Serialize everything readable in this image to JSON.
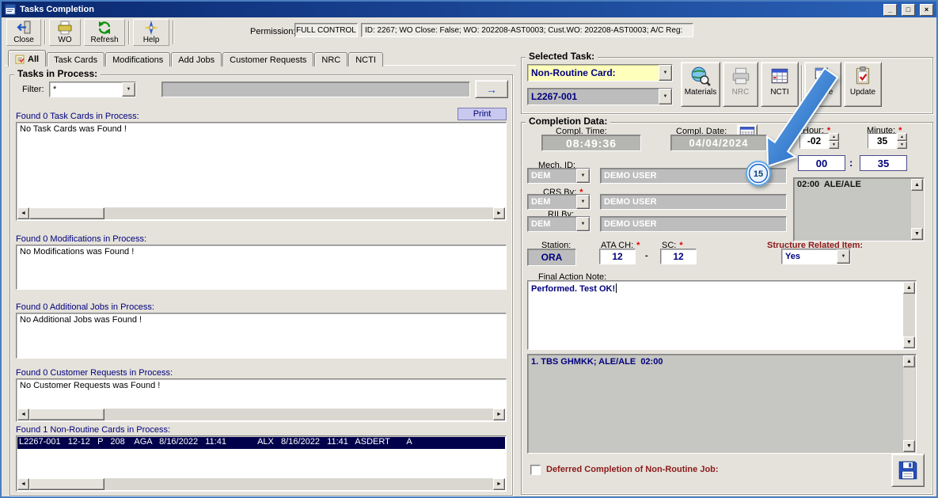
{
  "window": {
    "title": "Tasks Completion"
  },
  "icons": {
    "minimize": "_",
    "maximize": "□",
    "close_x": "×",
    "dropdown": "▼",
    "spin_up": "▲",
    "spin_down": "▼",
    "scroll_left": "◄",
    "scroll_right": "►",
    "scroll_up": "▲",
    "scroll_down": "▼",
    "go_arrow": "→"
  },
  "toolbar": {
    "close_label": "Close",
    "wo_label": "WO",
    "refresh_label": "Refresh",
    "help_label": "Help",
    "permission_label": "Permission:",
    "permission_value": "FULL CONTROL",
    "info_text": "ID: 2267; WO Close: False; WO: 202208-AST0003; Cust.WO: 202208-AST0003; A/C Reg:"
  },
  "tabs": [
    {
      "label": "All"
    },
    {
      "label": "Task Cards"
    },
    {
      "label": "Modifications"
    },
    {
      "label": "Add Jobs"
    },
    {
      "label": "Customer Requests"
    },
    {
      "label": "NRC"
    },
    {
      "label": "NCTI"
    }
  ],
  "tasks_in_process": {
    "title": "Tasks in Process:",
    "filter_label": "Filter:",
    "filter_value": "*",
    "print_label": "Print",
    "task_cards_header": "Found 0 Task Cards in Process:",
    "task_cards_empty": "No Task Cards was Found !",
    "modifications_header": "Found 0 Modifications in Process:",
    "modifications_empty": "No Modifications was Found !",
    "add_jobs_header": "Found 0 Additional Jobs in Process:",
    "add_jobs_empty": "No Additional Jobs was Found !",
    "customer_requests_header": "Found 0 Customer Requests in Process:",
    "customer_requests_empty": "No Customer Requests was Found !",
    "nrc_header": "Found 1 Non-Routine Cards in Process:",
    "nrc_row": "L2267-001   12-12   P   208    AGA   8/16/2022   11:41             ALX   8/16/2022   11:41   ASDERT       A"
  },
  "selected_task": {
    "title": "Selected Task:",
    "type_value": "Non-Routine Card:",
    "card_value": "L2267-001",
    "materials_label": "Materials",
    "nrc_label": "NRC",
    "ncti_label": "NCTI",
    "close_label": "Close",
    "update_label": "Update"
  },
  "completion_data": {
    "title": "Completion Data:",
    "compl_time_label": "Compl. Time:",
    "compl_time_value": "08:49:36",
    "compl_date_label": "Compl. Date:",
    "compl_date_value": "04/04/2024",
    "hour_label": "Hour:",
    "hour_value": "-02",
    "minute_label": "Minute:",
    "minute_value": "35",
    "required_marker": "*",
    "total_hour": "00",
    "time_colon": ":",
    "total_minute": "35",
    "mech_id_label": "Mech. ID:",
    "mech_id_value": "DEM",
    "mech_id_name": "DEMO USER",
    "hours_note": "02:00  ALE/ALE",
    "crs_by_label": "CRS By:",
    "crs_by_value": "DEM",
    "crs_by_name": "DEMO USER",
    "rii_by_label": "RII By:",
    "rii_by_value": "DEM",
    "rii_by_name": "DEMO USER",
    "station_label": "Station:",
    "station_value": "ORA",
    "ata_ch_label": "ATA CH:",
    "ata_ch_value": "12",
    "ata_sc_separator": "-",
    "sc_label": "SC:",
    "sc_value": "12",
    "structure_related_label": "Structure Related Item:",
    "structure_related_value": "Yes",
    "final_action_note_label": "Final Action Note:",
    "final_action_note_value": "Performed. Test OK!",
    "history_note": "1. TBS GHMKK; ALE/ALE  02:00",
    "deferred_label": "Deferred Completion of Non-Routine Job:"
  },
  "annotation": {
    "step": "15"
  }
}
